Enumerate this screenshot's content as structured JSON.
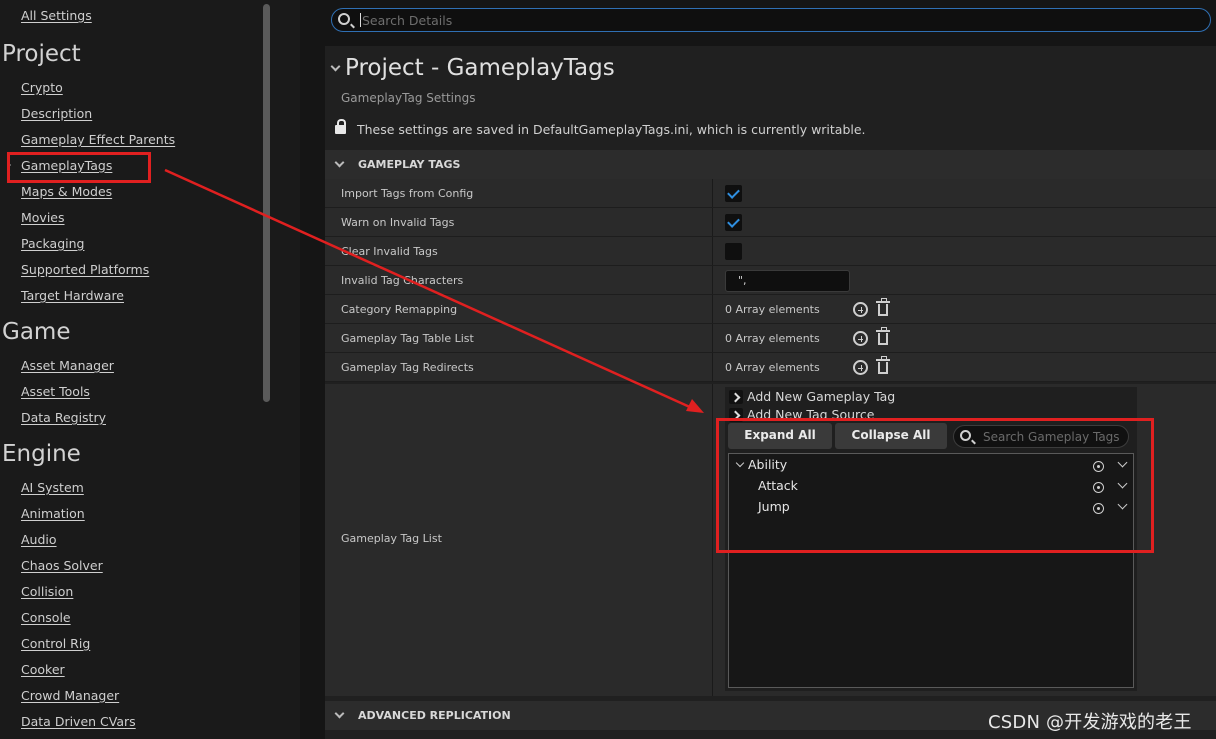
{
  "sidebar": {
    "top_link": "All Settings",
    "sections": [
      {
        "heading": "Project",
        "items": [
          "Crypto",
          "Description",
          "Gameplay Effect Parents",
          "GameplayTags",
          "Maps & Modes",
          "Movies",
          "Packaging",
          "Supported Platforms",
          "Target Hardware"
        ]
      },
      {
        "heading": "Game",
        "items": [
          "Asset Manager",
          "Asset Tools",
          "Data Registry"
        ]
      },
      {
        "heading": "Engine",
        "items": [
          "AI System",
          "Animation",
          "Audio",
          "Chaos Solver",
          "Collision",
          "Console",
          "Control Rig",
          "Cooker",
          "Crowd Manager",
          "Data Driven CVars"
        ]
      }
    ],
    "selected_item": "GameplayTags"
  },
  "search": {
    "placeholder": "Search Details"
  },
  "details": {
    "title": "Project - GameplayTags",
    "subtitle": "GameplayTag Settings",
    "save_note": "These settings are saved in DefaultGameplayTags.ini, which is currently writable.",
    "section_gameplay_tags": "GAMEPLAY TAGS",
    "rows": {
      "import_tags": {
        "label": "Import Tags from Config",
        "checked": true
      },
      "warn_invalid": {
        "label": "Warn on Invalid Tags",
        "checked": true
      },
      "clear_invalid": {
        "label": "Clear Invalid Tags",
        "checked": false
      },
      "invalid_chars": {
        "label": "Invalid Tag Characters",
        "value": "\","
      },
      "category_remapping": {
        "label": "Category Remapping",
        "value": "0 Array elements"
      },
      "table_list": {
        "label": "Gameplay Tag Table List",
        "value": "0 Array elements"
      },
      "redirects": {
        "label": "Gameplay Tag Redirects",
        "value": "0 Array elements"
      }
    },
    "tag_list": {
      "label": "Gameplay Tag List",
      "add_new_tag": "Add New Gameplay Tag",
      "add_new_source": "Add New Tag Source",
      "expand_all": "Expand All",
      "collapse_all": "Collapse All",
      "search_placeholder": "Search Gameplay Tags",
      "tags": {
        "root": "Ability",
        "children": [
          "Attack",
          "Jump"
        ]
      }
    },
    "section_advanced": "ADVANCED REPLICATION"
  },
  "watermark": "CSDN @开发游戏的老王",
  "colors": {
    "highlight": "#e02020",
    "accent": "#2f6fb3",
    "check": "#2f8fe0"
  }
}
